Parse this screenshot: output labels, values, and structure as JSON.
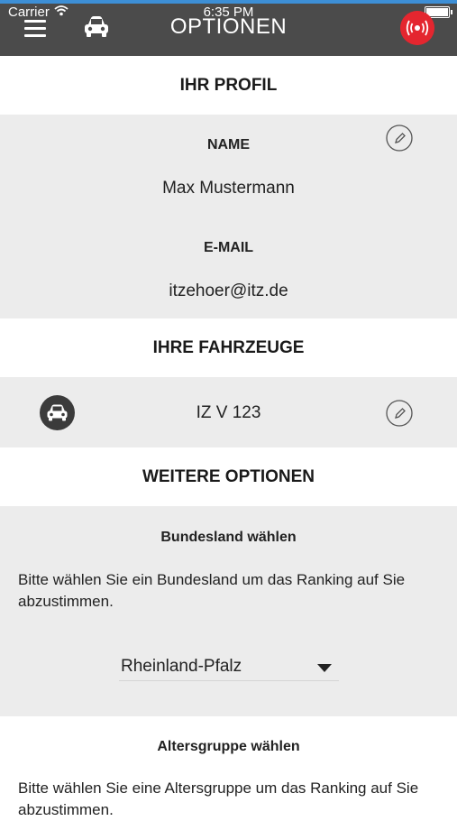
{
  "status_bar": {
    "carrier": "Carrier",
    "time": "6:35 PM"
  },
  "header": {
    "title": "OPTIONEN",
    "menu_icon": "hamburger-menu-icon",
    "car_icon": "car-icon",
    "live_icon": "broadcast-icon",
    "bar_color": "#4b4b4b",
    "live_color": "#e4262f"
  },
  "profile": {
    "section_title": "IHR PROFIL",
    "name_label": "NAME",
    "name_value": "Max Mustermann",
    "email_label": "E-MAIL",
    "email_value": "itzehoer@itz.de"
  },
  "vehicles": {
    "section_title": "IHRE FAHRZEUGE",
    "items": [
      {
        "plate": "IZ V 123"
      }
    ]
  },
  "more_options": {
    "section_title": "WEITERE OPTIONEN",
    "state": {
      "title": "Bundesland wählen",
      "description": "Bitte wählen Sie ein Bundesland um das Ranking auf Sie abzustimmen.",
      "selected": "Rheinland-Pfalz"
    },
    "age": {
      "title": "Altersgruppe wählen",
      "description": "Bitte wählen Sie eine Altersgruppe um das Ranking auf Sie abzustimmen."
    }
  }
}
